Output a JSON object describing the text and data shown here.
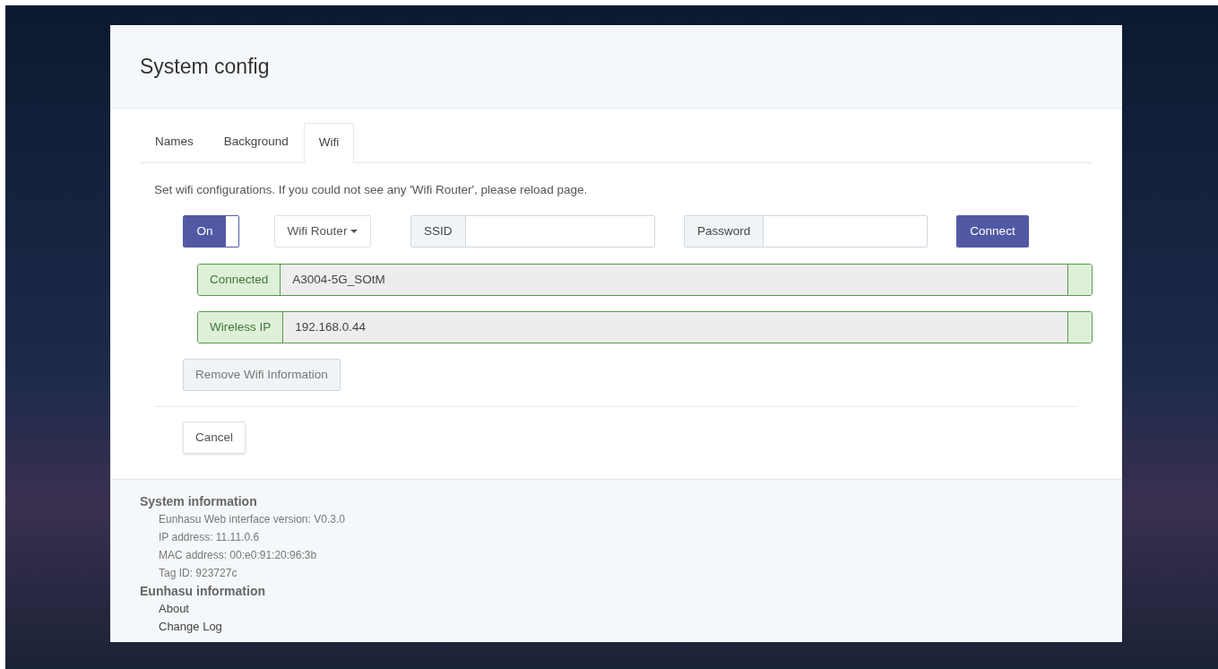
{
  "dialog": {
    "title": "System config"
  },
  "tabs": [
    {
      "label": "Names",
      "selected": false
    },
    {
      "label": "Background",
      "selected": false
    },
    {
      "label": "Wifi",
      "selected": true
    }
  ],
  "description": "Set wifi configurations. If you could not see any 'Wifi Router', please reload page.",
  "wifi_toggle": {
    "label": "On",
    "on": true
  },
  "router_dropdown": {
    "label": "Wifi Router"
  },
  "ssid_field": {
    "label": "SSID"
  },
  "password_field": {
    "label": "Password"
  },
  "connect_button": "Connect",
  "status_rows": [
    {
      "label": "Connected",
      "value": "A3004-5G_SOtM"
    },
    {
      "label": "Wireless IP",
      "value": "192.168.0.44"
    }
  ],
  "remove_button": "Remove Wifi Information",
  "cancel_button": "Cancel",
  "footer": [
    {
      "heading": "System information",
      "items": [
        "Eunhasu Web interface version: V0.3.0",
        "IP address: 11.11.0.6",
        "MAC address: 00:e0:91:20:96:3b",
        "Tag ID: 923727c"
      ],
      "kind": "info"
    },
    {
      "heading": "Eunhasu information",
      "items": [
        "About",
        "Change Log"
      ],
      "kind": "links"
    }
  ]
}
